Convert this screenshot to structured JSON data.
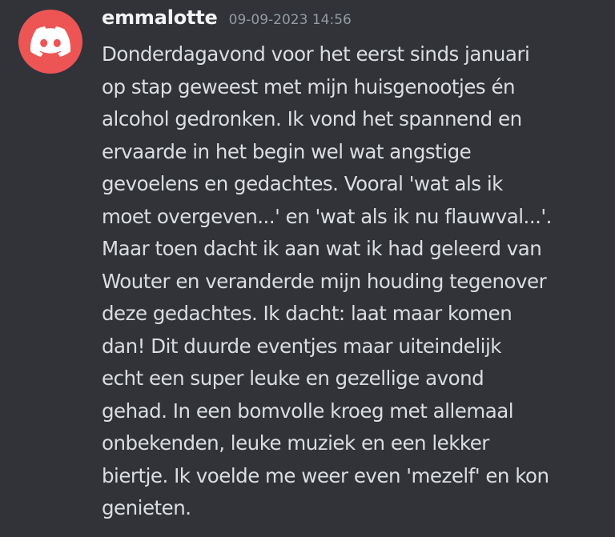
{
  "message": {
    "username": "emmalotte",
    "timestamp": "09-09-2023 14:56",
    "avatar_icon": "discord-logo-icon",
    "avatar_color": "#ed5555",
    "lines": [
      "Donderdagavond voor het eerst sinds januari",
      "op stap geweest met mijn huisgenootjes én",
      "alcohol gedronken. Ik vond het spannend en",
      "ervaarde in het begin wel wat angstige",
      "gevoelens en gedachtes. Vooral 'wat als ik",
      "moet overgeven...' en 'wat als ik nu flauwval...'.",
      "Maar toen dacht ik aan wat ik had geleerd van",
      "Wouter en veranderde mijn houding tegenover",
      "deze gedachtes. Ik dacht: laat maar komen",
      "dan! Dit duurde eventjes maar uiteindelijk",
      "echt een super leuke en gezellige avond",
      "gehad. In een bomvolle kroeg met allemaal",
      "onbekenden, leuke muziek en een lekker",
      "biertje. Ik voelde me weer even 'mezelf' en kon",
      "genieten."
    ]
  },
  "colors": {
    "background": "#313338",
    "username": "#f2f3f5",
    "timestamp": "#949ba4",
    "text": "#dbdee1"
  }
}
